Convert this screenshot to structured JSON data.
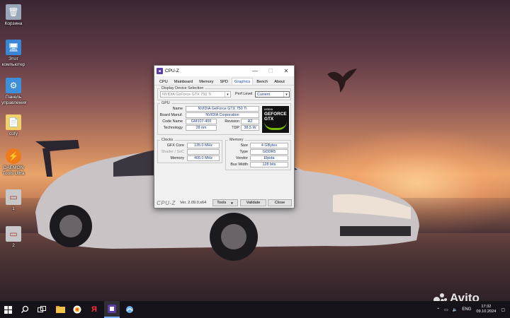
{
  "desktop_icons": [
    {
      "label": "Корзина",
      "icon": "recycle-bin-icon",
      "color": "#9aa7b8"
    },
    {
      "label": "Этот компьютер",
      "icon": "computer-icon",
      "color": "#3a86d4"
    },
    {
      "label": "Панель управления",
      "icon": "control-panel-icon",
      "color": "#3c8fd8"
    },
    {
      "label": "сofy",
      "icon": "document-file-icon",
      "color": "#f1d06a"
    },
    {
      "label": "DAEMON Tools Ultra",
      "icon": "daemon-tools-icon",
      "color": "#f07a1a"
    },
    {
      "label": "1",
      "icon": "image-file-icon",
      "color": "#c8c8c8"
    },
    {
      "label": "2",
      "icon": "image-file-icon",
      "color": "#c8c8c8"
    }
  ],
  "window": {
    "title": "CPU-Z",
    "tabs": [
      "CPU",
      "Mainboard",
      "Memory",
      "SPD",
      "Graphics",
      "Bench",
      "About"
    ],
    "active_tab": "Graphics",
    "display_selection": {
      "legend": "Display Device Selection",
      "device": "NVIDIA GeForce GTX 750 Ti",
      "perf_label": "Perf Level",
      "perf_value": "Current"
    },
    "gpu": {
      "legend": "GPU",
      "name_label": "Name",
      "name": "NVIDIA GeForce GTX 750 Ti",
      "board_label": "Board Manuf.",
      "board": "NVIDIA Corporation",
      "code_label": "Code Name",
      "code": "GM107-400",
      "revision_label": "Revision",
      "revision": "A2",
      "tech_label": "Technology",
      "tech": "28 nm",
      "tdp_label": "TDP",
      "tdp": "38.5 W",
      "logo_line1": "NVIDIA",
      "logo_line2": "GEFORCE GTX"
    },
    "clocks": {
      "legend": "Clocks",
      "gfx_label": "GFX Core",
      "gfx": "135.0 MHz",
      "shader_label": "Shader / SoC",
      "shader": "",
      "memory_label": "Memory",
      "memory": "405.0 MHz"
    },
    "memory": {
      "legend": "Memory",
      "size_label": "Size",
      "size": "4 GBytes",
      "type_label": "Type",
      "type": "GDDR5",
      "vendor_label": "Vendor",
      "vendor": "Elpida",
      "bus_label": "Bus Width",
      "bus": "128 bits"
    },
    "footer": {
      "brand": "CPU-Z",
      "version": "Ver. 2.09.0.x64",
      "tools": "Tools",
      "validate": "Validate",
      "close": "Close"
    }
  },
  "watermark": "Avito",
  "taskbar": {
    "icons": [
      "windows-start-icon",
      "search-icon",
      "task-view-icon",
      "file-explorer-icon",
      "yandex-browser-icon",
      "yandex-icon",
      "cpu-z-icon",
      "network-tool-icon"
    ],
    "language": "ENG",
    "time": "17:32",
    "date": "09.10.2024"
  }
}
